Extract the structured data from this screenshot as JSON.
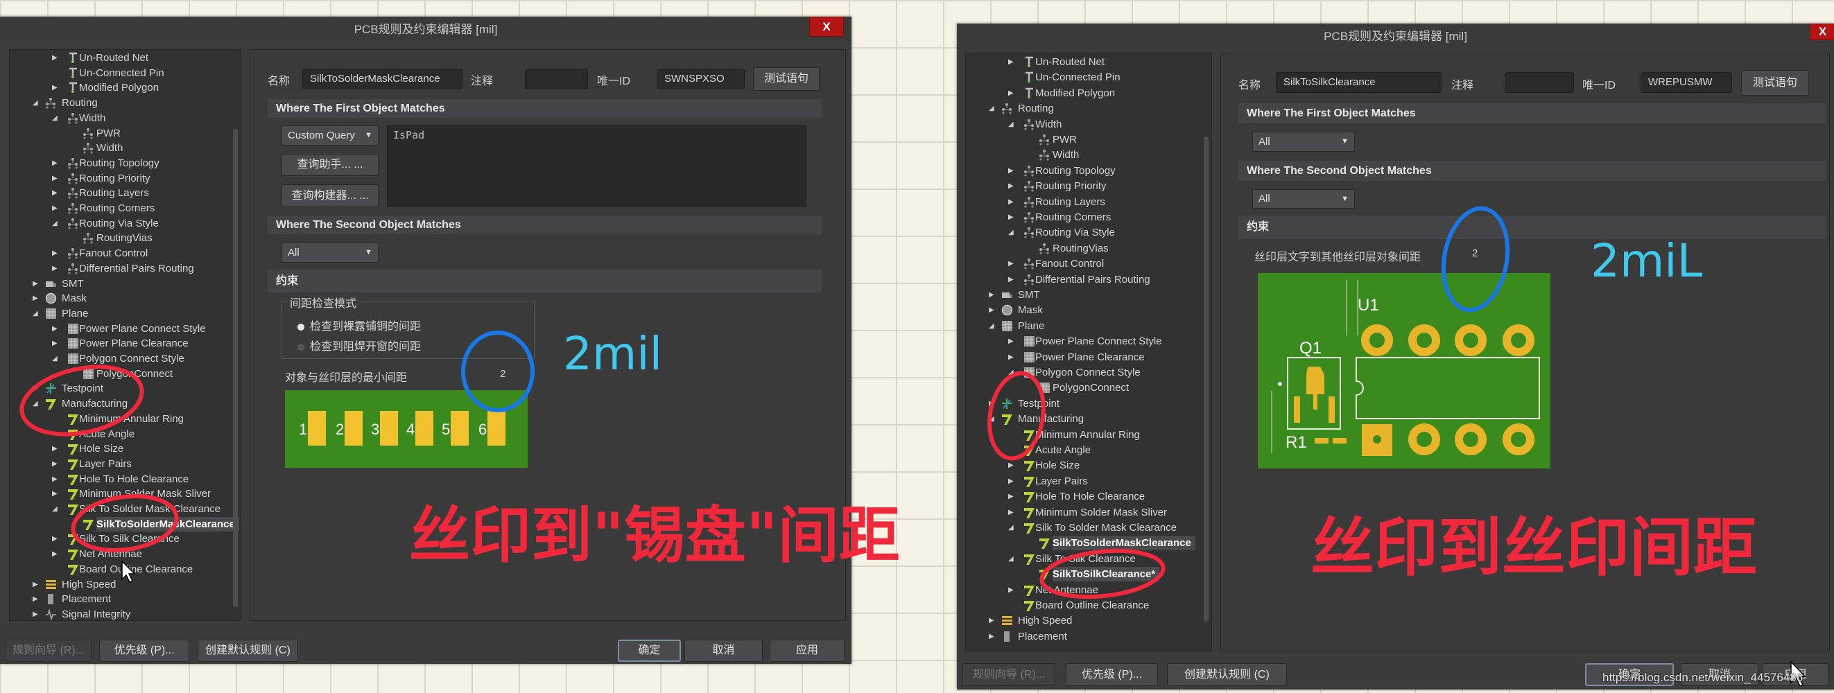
{
  "window_title": "PCB规则及约束编辑器 [mil]",
  "close_label": "X",
  "colors": {
    "dialog_bg": "#3b3b3c",
    "board_green": "#3a8a1e",
    "pad_yellow": "#f2c12e",
    "annotation_red": "#f0283c",
    "annotation_blue": "#1a78e6",
    "annotation_cyan": "#41c8ef",
    "close_red": "#b31414"
  },
  "dialogs": [
    {
      "tree": [
        {
          "label": "Un-Routed Net",
          "level": 1,
          "arrow": "right",
          "icon": "net"
        },
        {
          "label": "Un-Connected Pin",
          "level": 1,
          "arrow": "none",
          "icon": "net"
        },
        {
          "label": "Modified Polygon",
          "level": 1,
          "arrow": "right",
          "icon": "net"
        },
        {
          "label": "Routing",
          "level": 0,
          "arrow": "down",
          "icon": "routing"
        },
        {
          "label": "Width",
          "level": 1,
          "arrow": "down",
          "icon": "routing"
        },
        {
          "label": "PWR",
          "level": 2,
          "arrow": "none",
          "icon": "routing"
        },
        {
          "label": "Width",
          "level": 2,
          "arrow": "none",
          "icon": "routing"
        },
        {
          "label": "Routing Topology",
          "level": 1,
          "arrow": "right",
          "icon": "routing"
        },
        {
          "label": "Routing Priority",
          "level": 1,
          "arrow": "right",
          "icon": "routing"
        },
        {
          "label": "Routing Layers",
          "level": 1,
          "arrow": "right",
          "icon": "routing"
        },
        {
          "label": "Routing Corners",
          "level": 1,
          "arrow": "right",
          "icon": "routing"
        },
        {
          "label": "Routing Via Style",
          "level": 1,
          "arrow": "down",
          "icon": "routing"
        },
        {
          "label": "RoutingVias",
          "level": 2,
          "arrow": "none",
          "icon": "routing"
        },
        {
          "label": "Fanout Control",
          "level": 1,
          "arrow": "right",
          "icon": "routing"
        },
        {
          "label": "Differential Pairs Routing",
          "level": 1,
          "arrow": "right",
          "icon": "routing"
        },
        {
          "label": "SMT",
          "level": 0,
          "arrow": "right",
          "icon": "smt"
        },
        {
          "label": "Mask",
          "level": 0,
          "arrow": "right",
          "icon": "mask"
        },
        {
          "label": "Plane",
          "level": 0,
          "arrow": "down",
          "icon": "plane"
        },
        {
          "label": "Power Plane Connect Style",
          "level": 1,
          "arrow": "right",
          "icon": "plane"
        },
        {
          "label": "Power Plane Clearance",
          "level": 1,
          "arrow": "right",
          "icon": "plane"
        },
        {
          "label": "Polygon Connect Style",
          "level": 1,
          "arrow": "down",
          "icon": "plane"
        },
        {
          "label": "PolygonConnect",
          "level": 2,
          "arrow": "none",
          "icon": "plane"
        },
        {
          "label": "Testpoint",
          "level": 0,
          "arrow": "right",
          "icon": "testpoint"
        },
        {
          "label": "Manufacturing",
          "level": 0,
          "arrow": "down",
          "icon": "mfg"
        },
        {
          "label": "Minimum Annular Ring",
          "level": 1,
          "arrow": "none",
          "icon": "mfg"
        },
        {
          "label": "Acute Angle",
          "level": 1,
          "arrow": "none",
          "icon": "mfg"
        },
        {
          "label": "Hole Size",
          "level": 1,
          "arrow": "right",
          "icon": "mfg"
        },
        {
          "label": "Layer Pairs",
          "level": 1,
          "arrow": "right",
          "icon": "mfg"
        },
        {
          "label": "Hole To Hole Clearance",
          "level": 1,
          "arrow": "right",
          "icon": "mfg"
        },
        {
          "label": "Minimum Solder Mask Sliver",
          "level": 1,
          "arrow": "right",
          "icon": "mfg"
        },
        {
          "label": "Silk To Solder Mask Clearance",
          "level": 1,
          "arrow": "down",
          "icon": "mfg"
        },
        {
          "label": "SilkToSolderMaskClearance",
          "level": 2,
          "arrow": "none",
          "icon": "mfg",
          "selected": true
        },
        {
          "label": "Silk To Silk Clearance",
          "level": 1,
          "arrow": "right",
          "icon": "mfg"
        },
        {
          "label": "Net Antennae",
          "level": 1,
          "arrow": "right",
          "icon": "mfg"
        },
        {
          "label": "Board Outline Clearance",
          "level": 1,
          "arrow": "none",
          "icon": "mfg"
        },
        {
          "label": "High Speed",
          "level": 0,
          "arrow": "right",
          "icon": "highspeed"
        },
        {
          "label": "Placement",
          "level": 0,
          "arrow": "right",
          "icon": "placement"
        },
        {
          "label": "Signal Integrity",
          "level": 0,
          "arrow": "right",
          "icon": "signal"
        }
      ],
      "name_label": "名称",
      "name_value": "SilkToSolderMaskClearance",
      "comment_label": "注释",
      "comment_value": "",
      "uid_label": "唯一ID",
      "uid_value": "SWNSPXSO",
      "test_button": "测试语句",
      "first_header": "Where The First Object Matches",
      "first_query_type": "Custom Query",
      "first_query_text": "IsPad",
      "query_helper": "查询助手... ...",
      "query_builder": "查询构建器... ...",
      "second_header": "Where The Second Object Matches",
      "second_query_type": "All",
      "constraints_header": "约束",
      "check_mode_title": "间距检查模式",
      "check_mode_options": [
        {
          "label": "检查到裸露铺铜的间距",
          "selected": true
        },
        {
          "label": "检查到阻焊开窗的间距",
          "selected": false
        }
      ],
      "constraint_label": "对象与丝印层的最小间距",
      "constraint_value": "2",
      "preview_pads": [
        "1",
        "2",
        "3",
        "4",
        "5",
        "6"
      ],
      "footer": {
        "wizard": "规则向导 (R)...",
        "priority": "优先级 (P)...",
        "create_default": "创建默认规则 (C)",
        "ok": "确定",
        "cancel": "取消",
        "apply": "应用"
      }
    },
    {
      "tree": [
        {
          "label": "Un-Routed Net",
          "level": 1,
          "arrow": "right",
          "icon": "net"
        },
        {
          "label": "Un-Connected Pin",
          "level": 1,
          "arrow": "none",
          "icon": "net"
        },
        {
          "label": "Modified Polygon",
          "level": 1,
          "arrow": "right",
          "icon": "net"
        },
        {
          "label": "Routing",
          "level": 0,
          "arrow": "down",
          "icon": "routing"
        },
        {
          "label": "Width",
          "level": 1,
          "arrow": "down",
          "icon": "routing"
        },
        {
          "label": "PWR",
          "level": 2,
          "arrow": "none",
          "icon": "routing"
        },
        {
          "label": "Width",
          "level": 2,
          "arrow": "none",
          "icon": "routing"
        },
        {
          "label": "Routing Topology",
          "level": 1,
          "arrow": "right",
          "icon": "routing"
        },
        {
          "label": "Routing Priority",
          "level": 1,
          "arrow": "right",
          "icon": "routing"
        },
        {
          "label": "Routing Layers",
          "level": 1,
          "arrow": "right",
          "icon": "routing"
        },
        {
          "label": "Routing Corners",
          "level": 1,
          "arrow": "right",
          "icon": "routing"
        },
        {
          "label": "Routing Via Style",
          "level": 1,
          "arrow": "down",
          "icon": "routing"
        },
        {
          "label": "RoutingVias",
          "level": 2,
          "arrow": "none",
          "icon": "routing"
        },
        {
          "label": "Fanout Control",
          "level": 1,
          "arrow": "right",
          "icon": "routing"
        },
        {
          "label": "Differential Pairs Routing",
          "level": 1,
          "arrow": "right",
          "icon": "routing"
        },
        {
          "label": "SMT",
          "level": 0,
          "arrow": "right",
          "icon": "smt"
        },
        {
          "label": "Mask",
          "level": 0,
          "arrow": "right",
          "icon": "mask"
        },
        {
          "label": "Plane",
          "level": 0,
          "arrow": "down",
          "icon": "plane"
        },
        {
          "label": "Power Plane Connect Style",
          "level": 1,
          "arrow": "right",
          "icon": "plane"
        },
        {
          "label": "Power Plane Clearance",
          "level": 1,
          "arrow": "right",
          "icon": "plane"
        },
        {
          "label": "Polygon Connect Style",
          "level": 1,
          "arrow": "down",
          "icon": "plane"
        },
        {
          "label": "PolygonConnect",
          "level": 2,
          "arrow": "none",
          "icon": "plane"
        },
        {
          "label": "Testpoint",
          "level": 0,
          "arrow": "right",
          "icon": "testpoint"
        },
        {
          "label": "Manufacturing",
          "level": 0,
          "arrow": "down",
          "icon": "mfg"
        },
        {
          "label": "Minimum Annular Ring",
          "level": 1,
          "arrow": "none",
          "icon": "mfg"
        },
        {
          "label": "Acute Angle",
          "level": 1,
          "arrow": "none",
          "icon": "mfg"
        },
        {
          "label": "Hole Size",
          "level": 1,
          "arrow": "right",
          "icon": "mfg"
        },
        {
          "label": "Layer Pairs",
          "level": 1,
          "arrow": "right",
          "icon": "mfg"
        },
        {
          "label": "Hole To Hole Clearance",
          "level": 1,
          "arrow": "right",
          "icon": "mfg"
        },
        {
          "label": "Minimum Solder Mask Sliver",
          "level": 1,
          "arrow": "right",
          "icon": "mfg"
        },
        {
          "label": "Silk To Solder Mask Clearance",
          "level": 1,
          "arrow": "down",
          "icon": "mfg"
        },
        {
          "label": "SilkToSolderMaskClearance",
          "level": 2,
          "arrow": "none",
          "icon": "mfg",
          "bold": true
        },
        {
          "label": "Silk To Silk Clearance",
          "level": 1,
          "arrow": "down",
          "icon": "mfg"
        },
        {
          "label": "SilkToSilkClearance*",
          "level": 2,
          "arrow": "none",
          "icon": "mfg",
          "selected": true
        },
        {
          "label": "Net Antennae",
          "level": 1,
          "arrow": "right",
          "icon": "mfg"
        },
        {
          "label": "Board Outline Clearance",
          "level": 1,
          "arrow": "none",
          "icon": "mfg"
        },
        {
          "label": "High Speed",
          "level": 0,
          "arrow": "right",
          "icon": "highspeed"
        },
        {
          "label": "Placement",
          "level": 0,
          "arrow": "right",
          "icon": "placement"
        }
      ],
      "name_label": "名称",
      "name_value": "SilkToSilkClearance",
      "comment_label": "注释",
      "comment_value": "",
      "uid_label": "唯一ID",
      "uid_value": "WREPUSMW",
      "test_button": "测试语句",
      "first_header": "Where The First Object Matches",
      "first_query_type": "All",
      "second_header": "Where The Second Object Matches",
      "second_query_type": "All",
      "constraints_header": "约束",
      "constraint_label": "丝印层文字到其他丝印层对象间距",
      "constraint_value": "2",
      "preview_labels": {
        "u1": "U1",
        "q1": "Q1",
        "r1": "R1"
      },
      "footer": {
        "wizard": "规则向导 (R)...",
        "priority": "优先级 (P)...",
        "create_default": "创建默认规则 (C)",
        "ok": "确定",
        "cancel": "取消",
        "apply": "应用"
      }
    }
  ],
  "annotations": {
    "left_value_note": "2mil",
    "left_caption": "丝印到\"锡盘\"间距",
    "right_value_note": "2miL",
    "right_caption": "丝印到丝印间距"
  },
  "watermark": "https://blog.csdn.net/weixin_44576486"
}
